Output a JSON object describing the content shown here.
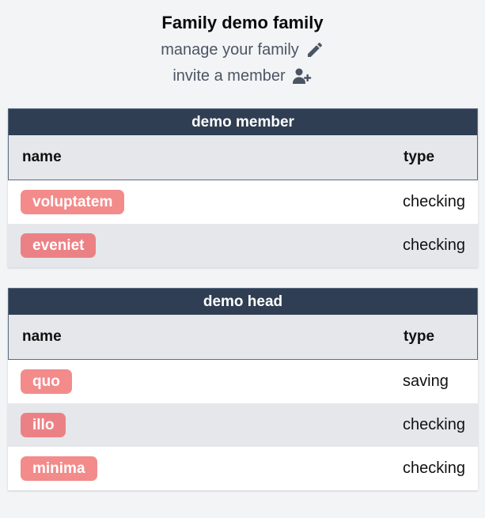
{
  "header": {
    "title": "Family demo family",
    "manage_label": "manage your family",
    "invite_label": "invite a member"
  },
  "icons": {
    "manage": "pencil-icon",
    "invite": "user-plus-icon"
  },
  "colors": {
    "group_title_bg": "#2f3e52",
    "pill": "#f38b8b",
    "alt_row": "#e5e7eb",
    "page_bg": "#f3f4f6"
  },
  "groups": [
    {
      "title": "demo member",
      "columns": {
        "name": "name",
        "type": "type"
      },
      "rows": [
        {
          "name": "voluptatem",
          "type": "checking"
        },
        {
          "name": "eveniet",
          "type": "checking"
        }
      ]
    },
    {
      "title": "demo head",
      "columns": {
        "name": "name",
        "type": "type"
      },
      "rows": [
        {
          "name": "quo",
          "type": "saving"
        },
        {
          "name": "illo",
          "type": "checking"
        },
        {
          "name": "minima",
          "type": "checking"
        }
      ]
    }
  ]
}
